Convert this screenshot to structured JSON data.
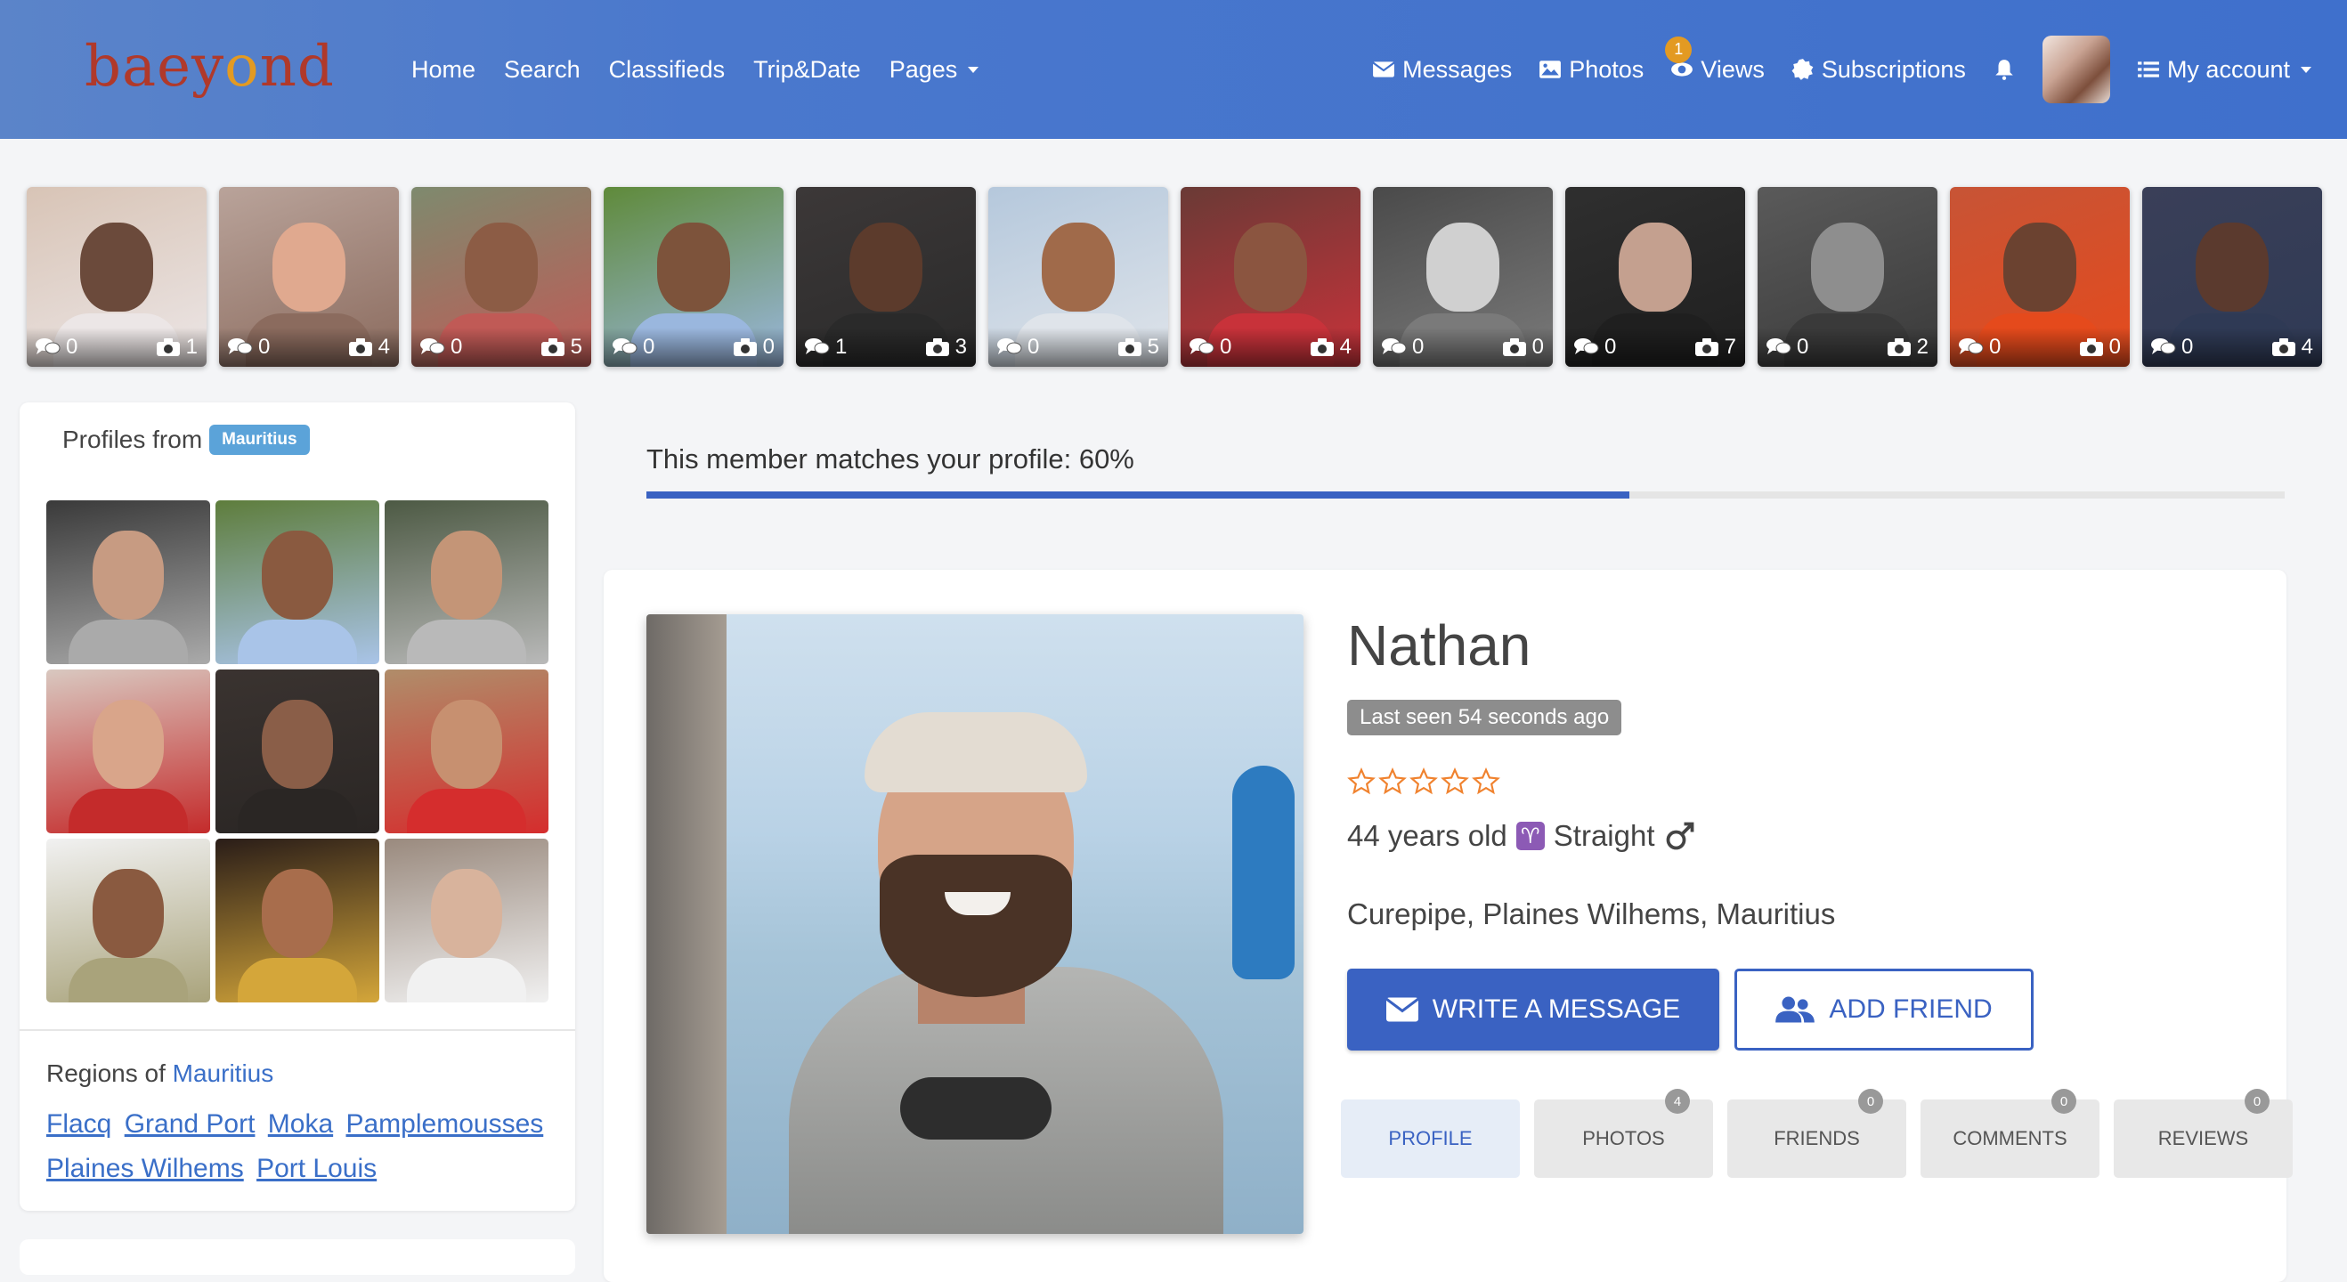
{
  "brand": {
    "logo_part1": "baey",
    "logo_mid": "o",
    "logo_part2": "nd"
  },
  "nav": {
    "left": [
      "Home",
      "Search",
      "Classifieds",
      "Trip&Date",
      "Pages"
    ],
    "messages": "Messages",
    "photos": "Photos",
    "views": "Views",
    "views_badge": "1",
    "subscriptions": "Subscriptions",
    "my_account": "My account"
  },
  "thumbs": [
    {
      "comments": "0",
      "photos": "1"
    },
    {
      "comments": "0",
      "photos": "4"
    },
    {
      "comments": "0",
      "photos": "5"
    },
    {
      "comments": "0",
      "photos": "0"
    },
    {
      "comments": "1",
      "photos": "3"
    },
    {
      "comments": "0",
      "photos": "5"
    },
    {
      "comments": "0",
      "photos": "4"
    },
    {
      "comments": "0",
      "photos": "0"
    },
    {
      "comments": "0",
      "photos": "7"
    },
    {
      "comments": "0",
      "photos": "2"
    },
    {
      "comments": "0",
      "photos": "0"
    },
    {
      "comments": "0",
      "photos": "4"
    }
  ],
  "sidebar": {
    "profiles_from": "Profiles from",
    "country_chip": "Mauritius",
    "regions_of": "Regions of",
    "country_link": "Mauritius",
    "regions": [
      "Flacq",
      "Grand Port",
      "Moka",
      "Pamplemousses",
      "Plaines Wilhems",
      "Port Louis"
    ]
  },
  "match": {
    "text": "This member matches your profile: 60%",
    "percent": 60
  },
  "profile": {
    "name": "Nathan",
    "last_seen": "Last seen 54 seconds ago",
    "rating": 0,
    "age": "44 years old",
    "zodiac": "♈",
    "orientation": "Straight",
    "location": "Curepipe, Plaines Wilhems, Mauritius",
    "write_message": "WRITE A MESSAGE",
    "add_friend": "ADD FRIEND"
  },
  "tabs": [
    {
      "label": "PROFILE",
      "badge": ""
    },
    {
      "label": "PHOTOS",
      "badge": "4"
    },
    {
      "label": "FRIENDS",
      "badge": "0"
    },
    {
      "label": "COMMENTS",
      "badge": "0"
    },
    {
      "label": "REVIEWS",
      "badge": "0"
    }
  ],
  "colors": {
    "navbar": "#3f70cc",
    "primary": "#3a62c2",
    "logo": "#b0392a",
    "badge": "#e39a22",
    "chip": "#5ba3d9",
    "link": "#3a6fc8"
  }
}
